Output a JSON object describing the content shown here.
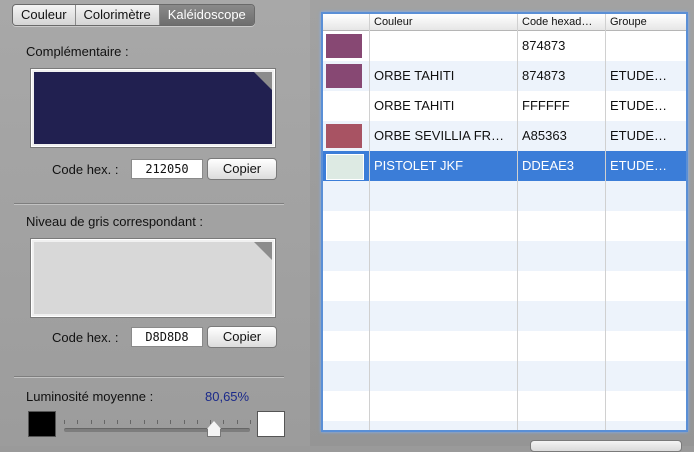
{
  "tabs": [
    "Couleur",
    "Colorimètre",
    "Kaléidoscope"
  ],
  "active_tab": 2,
  "complementary": {
    "title": "Complémentaire :",
    "color": "#212050",
    "hex_label": "Code hex. :",
    "hex_value": "212050",
    "copy_label": "Copier"
  },
  "grayscale": {
    "title": "Niveau de gris correspondant :",
    "color": "#D8D8D8",
    "hex_label": "Code hex. :",
    "hex_value": "D8D8D8",
    "copy_label": "Copier"
  },
  "luminosity": {
    "label": "Luminosité moyenne :",
    "value_text": "80,65%",
    "value": 0.8065,
    "dark_color": "#000000",
    "light_color": "#FFFFFF"
  },
  "table": {
    "headers": [
      "",
      "Couleur",
      "Code hexad…",
      "Groupe"
    ],
    "rows": [
      {
        "swatch": "#874873",
        "name": "",
        "hex": "874873",
        "group": ""
      },
      {
        "swatch": "#874873",
        "name": "ORBE TAHITI",
        "hex": "874873",
        "group": "ETUDE…"
      },
      {
        "swatch": "#FFFFFF",
        "name": "ORBE TAHITI",
        "hex": "FFFFFF",
        "group": "ETUDE…"
      },
      {
        "swatch": "#A85363",
        "name": "ORBE SEVILLIA FR…",
        "hex": "A85363",
        "group": "ETUDE…"
      },
      {
        "swatch": "#DDEAE3",
        "name": "PISTOLET JKF",
        "hex": "DDEAE3",
        "group": "ETUDE…"
      }
    ],
    "selected_row": 4
  }
}
